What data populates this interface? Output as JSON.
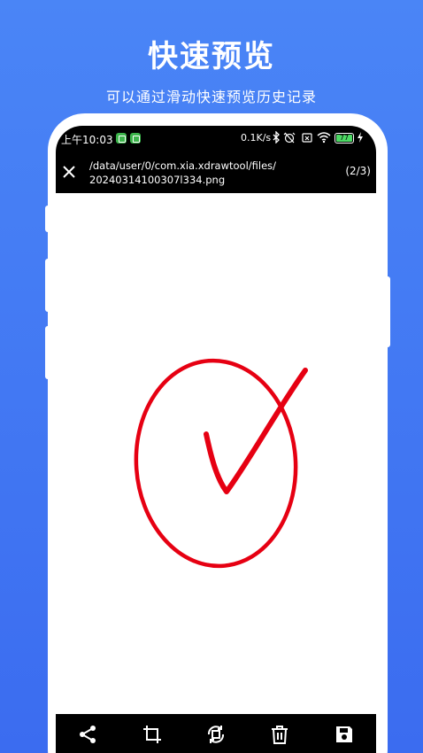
{
  "hero": {
    "title": "快速预览",
    "subtitle": "可以通过滑动快速预览历史记录"
  },
  "statusbar": {
    "time": "上午10:03",
    "net_speed": "0.1K/s",
    "battery": "77",
    "icons": [
      "app-notification-icon",
      "app-notification-icon",
      "bluetooth-icon",
      "alarm-off-icon",
      "sim-icon",
      "wifi-icon",
      "battery-icon",
      "charging-icon"
    ]
  },
  "toolbar": {
    "path_line1": "/data/user/0/com.xia.xdrawtool/files/",
    "path_line2": "20240314100307l334.png",
    "page_count": "(2/3)",
    "close_icon": "close-icon"
  },
  "drawing": {
    "stroke_color": "#e60012",
    "description_shapes": [
      "ellipse",
      "checkmark"
    ]
  },
  "bottombar": {
    "actions": [
      "share-icon",
      "crop-icon",
      "rotate-icon",
      "delete-icon",
      "save-icon"
    ]
  },
  "colors": {
    "background_top": "#4a85f6",
    "background_bottom": "#3b6cf0",
    "bar": "#000000",
    "battery": "#4cd964"
  }
}
